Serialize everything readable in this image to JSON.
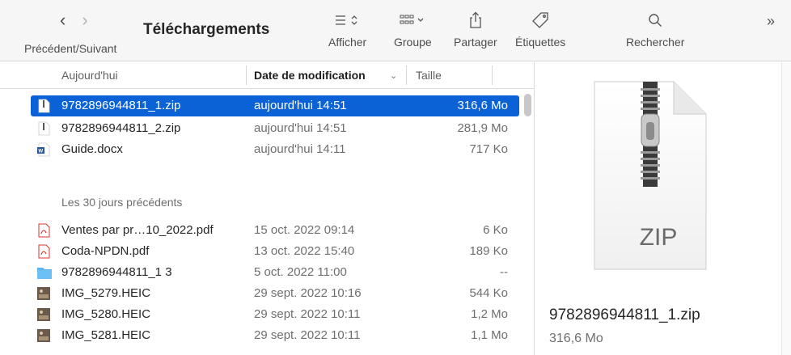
{
  "toolbar": {
    "nav_label": "Précédent/Suivant",
    "title": "Téléchargements",
    "afficher": "Afficher",
    "groupe": "Groupe",
    "partager": "Partager",
    "etiquettes": "Étiquettes",
    "rechercher": "Rechercher"
  },
  "columns": {
    "name": "Aujourd'hui",
    "date": "Date de modification",
    "size": "Taille"
  },
  "files_today": [
    {
      "name": "9782896944811_1.zip",
      "date": "aujourd'hui 14:51",
      "size": "316,6 Mo",
      "icon": "zip-icon",
      "selected": true
    },
    {
      "name": "9782896944811_2.zip",
      "date": "aujourd'hui 14:51",
      "size": "281,9 Mo",
      "icon": "zip-icon",
      "selected": false
    },
    {
      "name": "Guide.docx",
      "date": "aujourd'hui 14:11",
      "size": "717 Ko",
      "icon": "word-doc-icon",
      "selected": false
    }
  ],
  "section_label": "Les 30 jours précédents",
  "files_30days": [
    {
      "name": "Ventes par pr…10_2022.pdf",
      "date": "15 oct. 2022 09:14",
      "size": "6 Ko",
      "icon": "pdf-icon"
    },
    {
      "name": "Coda-NPDN.pdf",
      "date": "13 oct. 2022 15:40",
      "size": "189 Ko",
      "icon": "pdf-icon"
    },
    {
      "name": "9782896944811_1 3",
      "date": "5 oct. 2022 11:00",
      "size": "--",
      "icon": "folder-icon"
    },
    {
      "name": "IMG_5279.HEIC",
      "date": "29 sept. 2022 10:16",
      "size": "544 Ko",
      "icon": "image-icon"
    },
    {
      "name": "IMG_5280.HEIC",
      "date": "29 sept. 2022 10:11",
      "size": "1,2 Mo",
      "icon": "image-icon"
    },
    {
      "name": "IMG_5281.HEIC",
      "date": "29 sept. 2022 10:11",
      "size": "1,1 Mo",
      "icon": "image-icon"
    }
  ],
  "preview": {
    "badge": "ZIP",
    "filename": "9782896944811_1.zip",
    "size": "316,6 Mo"
  },
  "colors": {
    "selection": "#0a62d6",
    "folder": "#5ab4f0",
    "pdf": "#d9342b",
    "word": "#2b5797"
  }
}
